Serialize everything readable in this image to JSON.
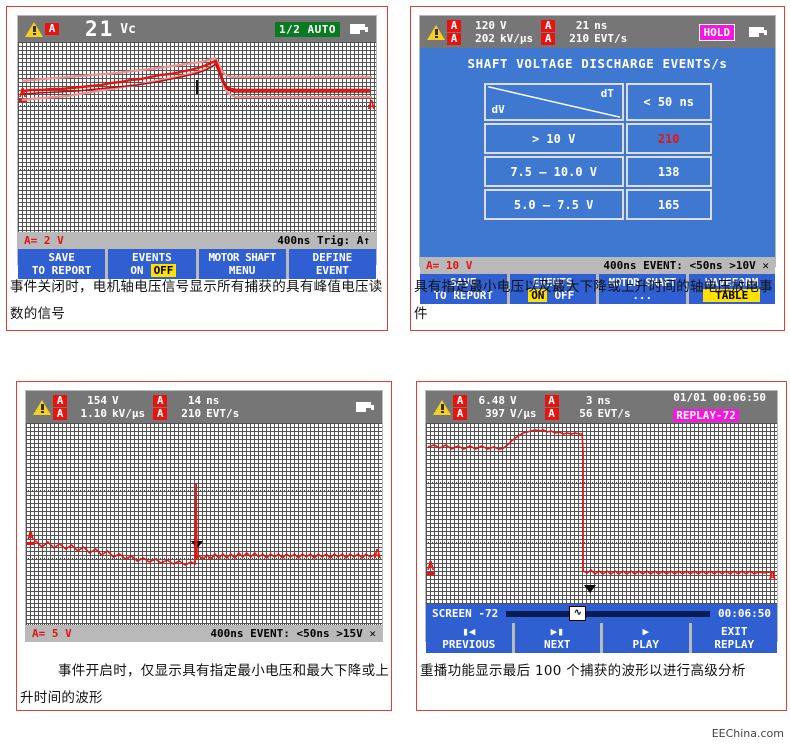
{
  "figures": [
    {
      "id": "events-off",
      "status": {
        "warning_icon": "warning-triangle-icon",
        "channel_badge": "A",
        "value": "21",
        "unit": "Vc",
        "mode_badge": "1/2 AUTO",
        "battery_icon": "battery-icon"
      },
      "info": {
        "left": "A= 2 V",
        "mid": "",
        "right": "400ns Trig: A↑"
      },
      "softkeys": [
        {
          "line1": "SAVE",
          "line2": "TO REPORT"
        },
        {
          "line1": "EVENTS",
          "on": "ON",
          "off": "OFF",
          "highlight": "off"
        },
        {
          "line1": "MOTOR SHAFT",
          "line2": "MENU"
        },
        {
          "line1": "DEFINE",
          "line2": "EVENT"
        }
      ],
      "caption": "事件关闭时，电机轴电压信号显示所有捕获的具有峰值电压读数的信号"
    },
    {
      "id": "waveform-table",
      "status": {
        "warning_icon": "warning-triangle-icon",
        "channel_badge_1": "A",
        "channel_badge_2": "A",
        "value_1": "120",
        "value_2": "202",
        "unit_1": "V",
        "unit_2": "kV/µs",
        "channel_badge_3": "A",
        "channel_badge_4": "A",
        "value_3": "21",
        "value_4": "210",
        "unit_3": "ns",
        "unit_4": "EVT/s",
        "mode_badge": "HOLD",
        "battery_icon": "battery-icon"
      },
      "table": {
        "title": "SHAFT VOLTAGE DISCHARGE EVENTS/s",
        "corner_row_label": "dV",
        "corner_col_label": "dT",
        "column_header": "< 50 ns",
        "rows": [
          {
            "label": "> 10 V",
            "value": "210",
            "highlight": true
          },
          {
            "label": "7.5 – 10.0 V",
            "value": "138",
            "highlight": false
          },
          {
            "label": "5.0 – 7.5 V",
            "value": "165",
            "highlight": false
          }
        ]
      },
      "info": {
        "left": "A= 10 V",
        "mid": "",
        "right": "400ns  EVENT: <50ns >10V ✕"
      },
      "softkeys": [
        {
          "line1": "SAVE",
          "line2": "TO REPORT"
        },
        {
          "line1": "EVENTS",
          "on": "ON",
          "off": "OFF",
          "highlight": "on"
        },
        {
          "line1": "MOTOR SHAFT",
          "line2": "..."
        },
        {
          "line1": "WAVEFORM",
          "line2": "TABLE",
          "highlight_line2": true
        }
      ],
      "caption": "具有指定最小电压以及最大下降或上升时间的轴电压放电事件"
    },
    {
      "id": "events-on",
      "status": {
        "warning_icon": "warning-triangle-icon",
        "channel_badge_1": "A",
        "channel_badge_2": "A",
        "value_1": "154",
        "value_2": "1.10",
        "unit_1": "V",
        "unit_2": "kV/µs",
        "channel_badge_3": "A",
        "channel_badge_4": "A",
        "value_3": "14",
        "value_4": "210",
        "unit_3": "ns",
        "unit_4": "EVT/s",
        "battery_icon": "battery-icon"
      },
      "info": {
        "left": "A= 5 V",
        "mid": "",
        "right": "400ns  EVENT: <50ns >15V ✕"
      },
      "caption": "事件开启时，仅显示具有指定最小电压和最大下降或上升时间的波形"
    },
    {
      "id": "replay",
      "status": {
        "warning_icon": "warning-triangle-icon",
        "channel_badge_1": "A",
        "channel_badge_2": "A",
        "value_1": "6.48",
        "value_2": "397",
        "unit_1": "V",
        "unit_2": "V/µs",
        "channel_badge_3": "A",
        "channel_badge_4": "A",
        "value_3": "3",
        "value_4": "56",
        "unit_3": "ns",
        "unit_4": "EVT/s",
        "datetime": "01/01 00:06:50",
        "mode_badge": "REPLAY-72",
        "battery_icon": "battery-icon"
      },
      "replay": {
        "screen_label": "SCREEN -72",
        "time": "00:06:50",
        "slider_icon": "waveform-knob-icon"
      },
      "softkeys": [
        {
          "icon": "skip-previous-icon",
          "line2": "PREVIOUS"
        },
        {
          "icon": "skip-next-icon",
          "line2": "NEXT"
        },
        {
          "icon": "play-icon",
          "line2": "PLAY"
        },
        {
          "line1": "EXIT",
          "line2": "REPLAY"
        }
      ],
      "caption": "重播功能显示最后 100 个捕获的波形以进行高级分析"
    }
  ],
  "watermark": "EEChina.com",
  "colors": {
    "panel_border": "#e04030",
    "status_bg": "#767676",
    "softkey_blue": "#2f5fd0",
    "table_blue": "#3f78d0",
    "trace_red": "#e8130f",
    "trace_pink": "#f08f90",
    "highlight_yellow": "#ffe000",
    "auto_green": "#0a7a22",
    "hold_magenta": "#f218e0"
  }
}
